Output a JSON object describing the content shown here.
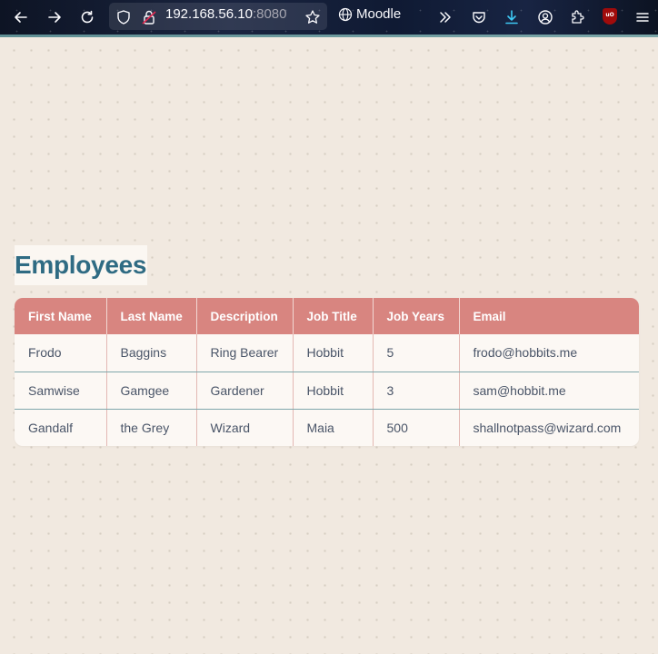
{
  "browser": {
    "url_host": "192.168.56.10",
    "url_port": ":8080",
    "tab_title": "Moodle",
    "icons": [
      "back-icon",
      "forward-icon",
      "reload-icon",
      "shield-icon",
      "lock-icon",
      "star-icon",
      "globe-icon",
      "overflow-chevrons-icon",
      "pocket-icon",
      "download-icon",
      "account-icon",
      "extensions-icon",
      "ublock-icon",
      "menu-icon"
    ],
    "ublock_label": "uO"
  },
  "page": {
    "title": "Employees"
  },
  "table": {
    "headers": [
      "First Name",
      "Last Name",
      "Description",
      "Job Title",
      "Job Years",
      "Email"
    ],
    "rows": [
      [
        "Frodo",
        "Baggins",
        "Ring Bearer",
        "Hobbit",
        "5",
        "frodo@hobbits.me"
      ],
      [
        "Samwise",
        "Gamgee",
        "Gardener",
        "Hobbit",
        "3",
        "sam@hobbit.me"
      ],
      [
        "Gandalf",
        "the Grey",
        "Wizard",
        "Maia",
        "500",
        "shallnotpass@wizard.com"
      ]
    ]
  },
  "colors": {
    "title": "#2f6b83",
    "header_bg": "#d88580",
    "page_bg": "#f1e9e0",
    "row_divider": "#7fa7ab"
  }
}
